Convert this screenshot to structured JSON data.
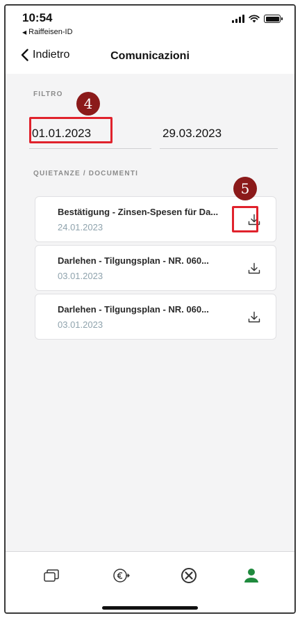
{
  "status_bar": {
    "time": "10:54",
    "back_app": "Raiffeisen-ID",
    "back_app_arrow": "◀"
  },
  "navbar": {
    "back_label": "Indietro",
    "title": "Comunicazioni"
  },
  "filter": {
    "section_label": "FILTRO",
    "date_from": "01.01.2023",
    "date_to": "29.03.2023"
  },
  "documents": {
    "section_label": "QUIETANZE / DOCUMENTI",
    "items": [
      {
        "title": "Bestätigung - Zinsen-Spesen für Da...",
        "date": "24.01.2023",
        "icon": "download-icon"
      },
      {
        "title": "Darlehen - Tilgungsplan - NR. 060...",
        "date": "03.01.2023",
        "icon": "download-icon"
      },
      {
        "title": "Darlehen - Tilgungsplan - NR. 060...",
        "date": "03.01.2023",
        "icon": "download-icon"
      }
    ]
  },
  "annotations": {
    "marker_date": "4",
    "marker_download": "5"
  },
  "tabbar": {
    "tabs": [
      {
        "icon": "cards-icon",
        "active": false
      },
      {
        "icon": "euro-transfer-icon",
        "active": false
      },
      {
        "icon": "close-circle-icon",
        "active": false
      },
      {
        "icon": "profile-icon",
        "active": true
      }
    ]
  },
  "colors": {
    "accent_green": "#1f8a3d",
    "annotation_red": "#e0222c",
    "marker_maroon": "#8b1a1a",
    "date_muted": "#8fa3ad"
  }
}
